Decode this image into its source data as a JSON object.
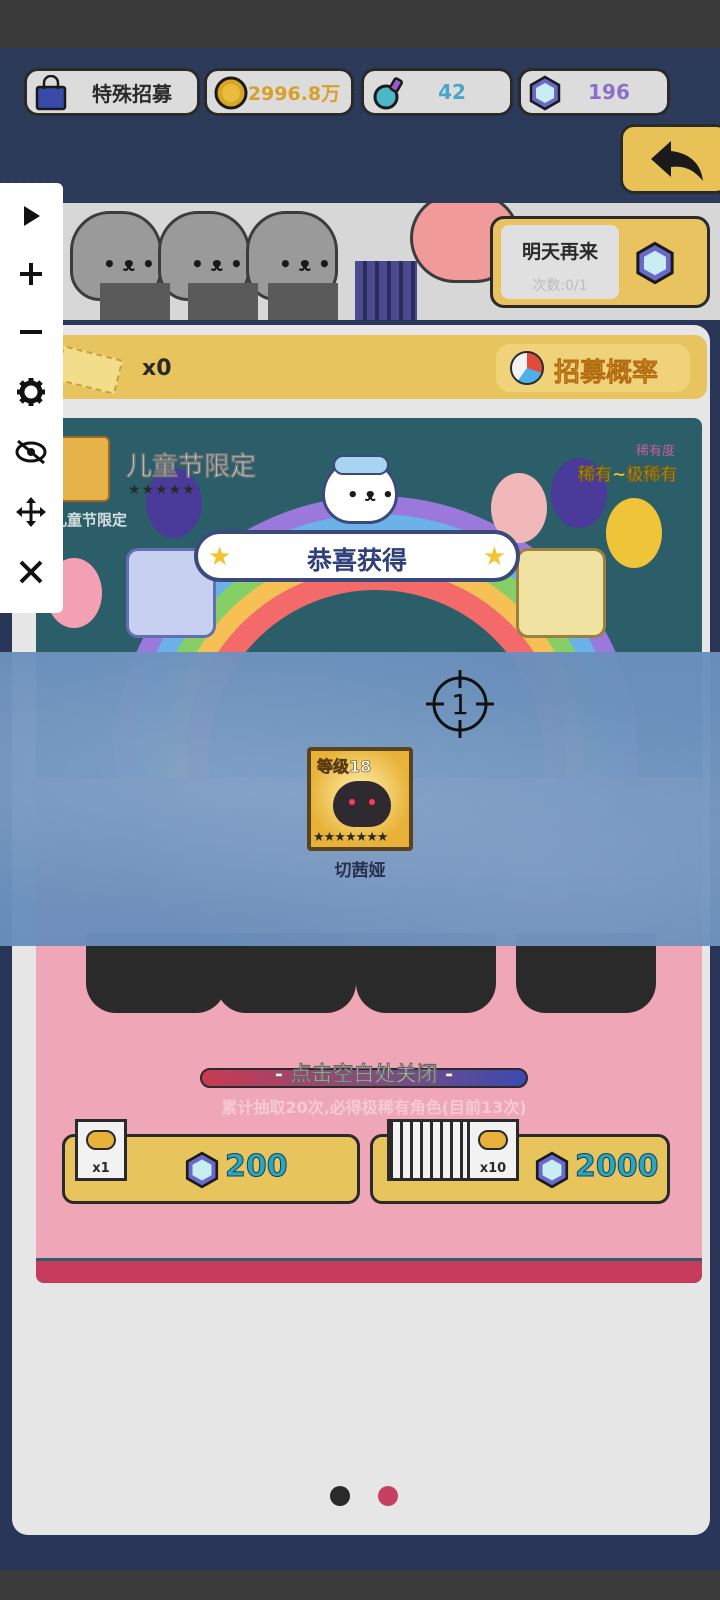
{
  "resources": {
    "recruit_label": "特殊招募",
    "gold": "2996.8万",
    "potion": "42",
    "gems": "196"
  },
  "tomorrow_card": {
    "title": "明天再来",
    "count": "次数:0/1"
  },
  "ticket": {
    "count": "x0"
  },
  "rate_button": "招募概率",
  "pool": {
    "title": "儿童节限定",
    "stars": "★★★★★",
    "subtitle": "儿童节限定",
    "rarity_label": "稀有度",
    "rarity_value": "稀有~极稀有"
  },
  "reward": {
    "banner": "恭喜获得",
    "level": "等级18",
    "stars": "★★★★★★★",
    "name": "切茜娅",
    "stars_filled": 5,
    "stars_total": 7
  },
  "close_hint": "- 点击空白处关闭 -",
  "pity_text": "累计抽取20次,必得极稀有角色(目前13次)",
  "draw_single": {
    "count": "x1",
    "cost": "200"
  },
  "draw_ten": {
    "count": "x10",
    "cost": "2000"
  },
  "crosshair_label": "1",
  "pager": {
    "total": 2,
    "active": 1
  },
  "colors": {
    "navy": "#2c3a5a",
    "gold": "#e8c45e",
    "reward_strip": "#6f94bf",
    "gem_cost": "#28a8b8",
    "dot_inactive": "#2a2a2a",
    "dot_active": "#c84060"
  },
  "toolbar": [
    "play-icon",
    "plus-icon",
    "minus-icon",
    "gear-icon",
    "eye-off-icon",
    "move-icon",
    "close-icon"
  ]
}
